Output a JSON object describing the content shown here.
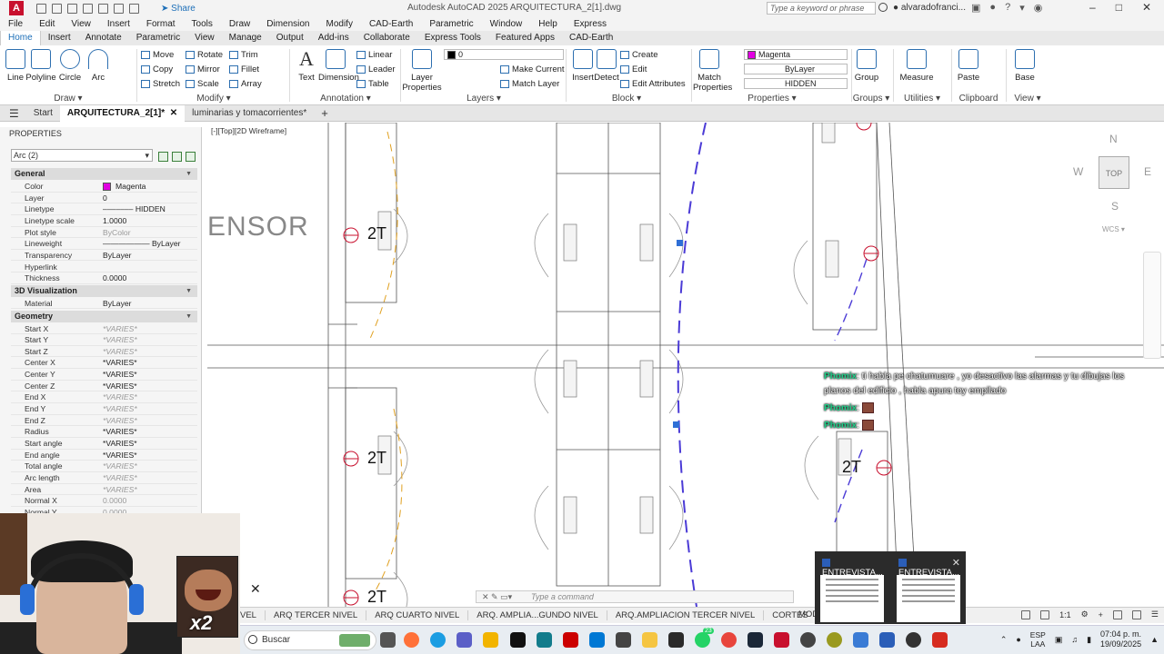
{
  "title_bar": {
    "app_title": "Autodesk AutoCAD 2025   ARQUITECTURA_2[1].dwg",
    "share_label": "Share",
    "search_placeholder": "Type a keyword or phrase",
    "user_name": "alvaradofranci..."
  },
  "menu": [
    "File",
    "Edit",
    "View",
    "Insert",
    "Format",
    "Tools",
    "Draw",
    "Dimension",
    "Modify",
    "CAD-Earth",
    "Parametric",
    "Window",
    "Help",
    "Express"
  ],
  "ribbon_tabs": [
    "Home",
    "Insert",
    "Annotate",
    "Parametric",
    "View",
    "Manage",
    "Output",
    "Add-ins",
    "Collaborate",
    "Express Tools",
    "Featured Apps",
    "CAD-Earth"
  ],
  "ribbon": {
    "draw": {
      "title": "Draw",
      "buttons": [
        "Line",
        "Polyline",
        "Circle",
        "Arc"
      ]
    },
    "modify": {
      "title": "Modify",
      "buttons": [
        "Move",
        "Rotate",
        "Trim",
        "Copy",
        "Mirror",
        "Fillet",
        "Stretch",
        "Scale",
        "Array"
      ]
    },
    "annotation": {
      "title": "Annotation",
      "buttons": [
        "Text",
        "Dimension",
        "Linear",
        "Leader",
        "Table"
      ]
    },
    "layers": {
      "title": "Layers",
      "layer_props": "Layer Properties",
      "current_layer": "0",
      "make_current": "Make Current",
      "match_layer": "Match Layer"
    },
    "block": {
      "title": "Block",
      "insert": "Insert",
      "detect": "Detect",
      "create": "Create",
      "edit": "Edit",
      "edit_attributes": "Edit Attributes"
    },
    "properties": {
      "title": "Properties",
      "match": "Match Properties",
      "color": "Magenta",
      "lineweight": "ByLayer",
      "linetype": "HIDDEN"
    },
    "groups": {
      "title": "Groups",
      "group": "Group"
    },
    "utilities": {
      "title": "Utilities",
      "measure": "Measure"
    },
    "clipboard": {
      "title": "Clipboard",
      "paste": "Paste"
    },
    "view": {
      "title": "View",
      "base": "Base"
    }
  },
  "file_tabs": [
    "Start",
    "ARQUITECTURA_2[1]*",
    "luminarias y tomacorrientes*"
  ],
  "properties_panel": {
    "header": "PROPERTIES",
    "selection": "Arc (2)",
    "sections": {
      "general": "General",
      "visualization": "3D Visualization",
      "geometry": "Geometry"
    },
    "general_rows": [
      {
        "k": "Color",
        "v": "Magenta"
      },
      {
        "k": "Layer",
        "v": "0"
      },
      {
        "k": "Linetype",
        "v": "––––––– HIDDEN"
      },
      {
        "k": "Linetype scale",
        "v": "1.0000"
      },
      {
        "k": "Plot style",
        "v": "ByColor"
      },
      {
        "k": "Lineweight",
        "v": "—————— ByLayer"
      },
      {
        "k": "Transparency",
        "v": "ByLayer"
      },
      {
        "k": "Hyperlink",
        "v": ""
      },
      {
        "k": "Thickness",
        "v": "0.0000"
      }
    ],
    "visualization_rows": [
      {
        "k": "Material",
        "v": "ByLayer"
      }
    ],
    "geometry_rows": [
      {
        "k": "Start X",
        "v": "*VARIES*"
      },
      {
        "k": "Start Y",
        "v": "*VARIES*"
      },
      {
        "k": "Start Z",
        "v": "*VARIES*"
      },
      {
        "k": "Center X",
        "v": "*VARIES*"
      },
      {
        "k": "Center Y",
        "v": "*VARIES*"
      },
      {
        "k": "Center Z",
        "v": "*VARIES*"
      },
      {
        "k": "End X",
        "v": "*VARIES*"
      },
      {
        "k": "End Y",
        "v": "*VARIES*"
      },
      {
        "k": "End Z",
        "v": "*VARIES*"
      },
      {
        "k": "Radius",
        "v": "*VARIES*"
      },
      {
        "k": "Start angle",
        "v": "*VARIES*"
      },
      {
        "k": "End angle",
        "v": "*VARIES*"
      },
      {
        "k": "Total angle",
        "v": "*VARIES*"
      },
      {
        "k": "Arc length",
        "v": "*VARIES*"
      },
      {
        "k": "Area",
        "v": "*VARIES*"
      },
      {
        "k": "Normal X",
        "v": "0.0000"
      },
      {
        "k": "Normal Y",
        "v": "0.0000"
      }
    ]
  },
  "drawing": {
    "viewport_label": "[-][Top][2D Wireframe]",
    "text_sensor": "ENSOR",
    "labels": [
      "2T",
      "2T",
      "2T",
      "2T"
    ],
    "viewcube": {
      "n": "N",
      "s": "S",
      "e": "E",
      "w": "W",
      "top": "TOP",
      "wcs": "WCS"
    }
  },
  "chat": [
    {
      "user": "Phomix",
      "message": ": ti habla pe chatumuare , yo desactivo las alarmas y tu dibujas los"
    },
    {
      "user": "",
      "message": "planos del edificio , habla apura toy empilado"
    },
    {
      "user": "Phomix",
      "message": ":"
    },
    {
      "user": "Phomix",
      "message": ":"
    }
  ],
  "command_line": {
    "placeholder": "Type a command"
  },
  "layout_tabs": [
    "VEL",
    "ARQ TERCER NIVEL",
    "ARQ CUARTO NIVEL",
    "ARQ. AMPLIA...GUNDO NIVEL",
    "ARQ.AMPLIACION TERCER NIVEL",
    "CORTES"
  ],
  "status": {
    "model": "MOD",
    "scale": "1:1"
  },
  "thumbnails": [
    "ENTREVISTA...",
    "ENTREVISTA..."
  ],
  "meme_overlay": "x2",
  "taskbar": {
    "search_label": "Buscar",
    "lang": "ESP",
    "lang2": "LAA",
    "time": "07:04 p. m.",
    "date": "19/09/2025",
    "badge": "23"
  },
  "colors": {
    "accent": "#1d6fb8",
    "magenta": "#e200e2",
    "arc": "#4b3bd6",
    "chat_user": "#20d08a"
  }
}
